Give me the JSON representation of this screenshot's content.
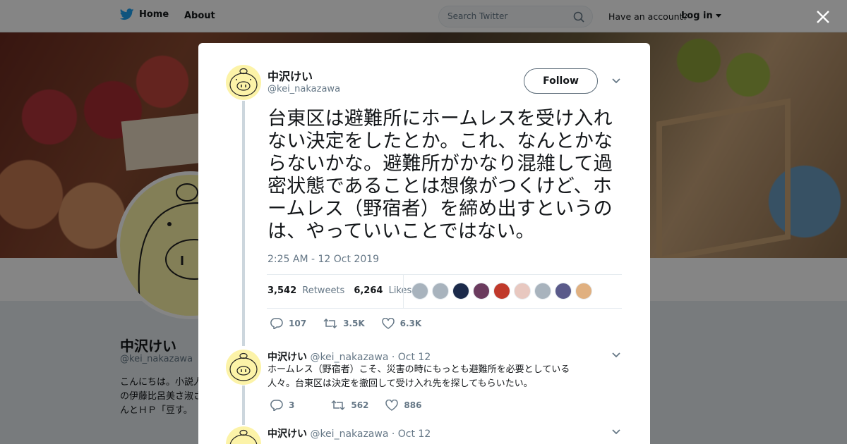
{
  "nav": {
    "home_label": "Home",
    "about_label": "About",
    "search_placeholder": "Search Twitter",
    "have_account": "Have an account?",
    "login_label": "Log in"
  },
  "profile": {
    "name": "中沢けい",
    "handle": "@kei_nakazawa",
    "bio": "こんにちは。小説人の伊藤比呂美さ淑さんとＨＰ「豆す。"
  },
  "tweet": {
    "name": "中沢けい",
    "handle": "@kei_nakazawa",
    "follow_label": "Follow",
    "text": "台東区は避難所にホームレスを受け入れない決定をしたとか。これ、なんとかならないかな。避難所がかなり混雑して過密状態であることは想像がつくけど、ホームレス（野宿者）を締め出すというのは、やっていいことではない。",
    "timestamp": "2:25 AM - 12 Oct 2019",
    "retweets_count": "3,542",
    "retweets_label": "Retweets",
    "likes_count": "6,264",
    "likes_label": "Likes",
    "reply_count": "107",
    "retweet_short": "3.5K",
    "like_short": "6.3K",
    "likers": [
      "#a8b3bd",
      "#a8b3bd",
      "#1b2a4a",
      "#6b3b5e",
      "#c0392b",
      "#e8c8c0",
      "#a8b3bd",
      "#5a5a8a",
      "#e0b080"
    ]
  },
  "replies": [
    {
      "name": "中沢けい",
      "handle": "@kei_nakazawa",
      "date": "· Oct 12",
      "text_line1": "ホームレス（野宿者）こそ、災害の時にもっとも避難所を必要としている",
      "text_line2": "人々。台東区は決定を撤回して受け入れ先を探してもらいたい。",
      "reply_count": "3",
      "retweet_count": "562",
      "like_count": "886"
    },
    {
      "name": "中沢けい",
      "handle": "@kei_nakazawa",
      "date": "· Oct 12"
    }
  ],
  "colors": {
    "accent": "#1da1f2",
    "muted": "#657786",
    "text": "#14171a",
    "border": "#e6ecf0"
  }
}
